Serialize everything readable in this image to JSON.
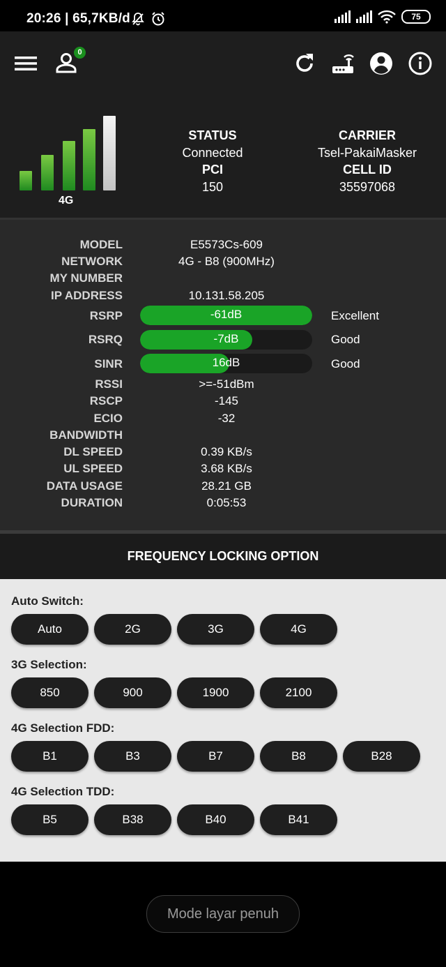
{
  "status_bar": {
    "time_speed": "20:26 | 65,7KB/d",
    "battery": "75"
  },
  "toolbar": {
    "user_badge": "0"
  },
  "hero": {
    "network_type": "4G",
    "status_label": "STATUS",
    "status_value": "Connected",
    "pci_label": "PCI",
    "pci_value": "150",
    "carrier_label": "CARRIER",
    "carrier_value": "Tsel-PakaiMasker",
    "cellid_label": "CELL ID",
    "cellid_value": "35597068"
  },
  "info": {
    "model_label": "MODEL",
    "model_value": "E5573Cs-609",
    "network_label": "NETWORK",
    "network_value": "4G - B8 (900MHz)",
    "mynumber_label": "MY NUMBER",
    "ip_label": "IP ADDRESS",
    "ip_value": "10.131.58.205",
    "rsrp_label": "RSRP",
    "rsrp_value": "-61dB",
    "rsrp_quality": "Excellent",
    "rsrp_level": 1.0,
    "rsrq_label": "RSRQ",
    "rsrq_value": "-7dB",
    "rsrq_quality": "Good",
    "rsrq_level": 0.65,
    "sinr_label": "SINR",
    "sinr_value": "16dB",
    "sinr_quality": "Good",
    "sinr_level": 0.52,
    "rssi_label": "RSSI",
    "rssi_value": ">=-51dBm",
    "rscp_label": "RSCP",
    "rscp_value": "-145",
    "ecio_label": "ECIO",
    "ecio_value": "-32",
    "bandwidth_label": "BANDWIDTH",
    "dl_label": "DL SPEED",
    "dl_value": "0.39 KB/s",
    "ul_label": "UL SPEED",
    "ul_value": "3.68 KB/s",
    "usage_label": "DATA USAGE",
    "usage_value": "28.21 GB",
    "duration_label": "DURATION",
    "duration_value": "0:05:53"
  },
  "frequency_lock": {
    "header": "FREQUENCY LOCKING OPTION",
    "auto_switch": {
      "title": "Auto Switch:",
      "options": [
        "Auto",
        "2G",
        "3G",
        "4G"
      ]
    },
    "sel_3g": {
      "title": "3G Selection:",
      "options": [
        "850",
        "900",
        "1900",
        "2100"
      ]
    },
    "sel_4g_fdd": {
      "title": "4G Selection FDD:",
      "options": [
        "B1",
        "B3",
        "B7",
        "B8",
        "B28"
      ]
    },
    "sel_4g_tdd": {
      "title": "4G Selection TDD:",
      "options": [
        "B5",
        "B38",
        "B40",
        "B41"
      ]
    }
  },
  "bottom": {
    "fullscreen_label": "Mode layar penuh"
  }
}
